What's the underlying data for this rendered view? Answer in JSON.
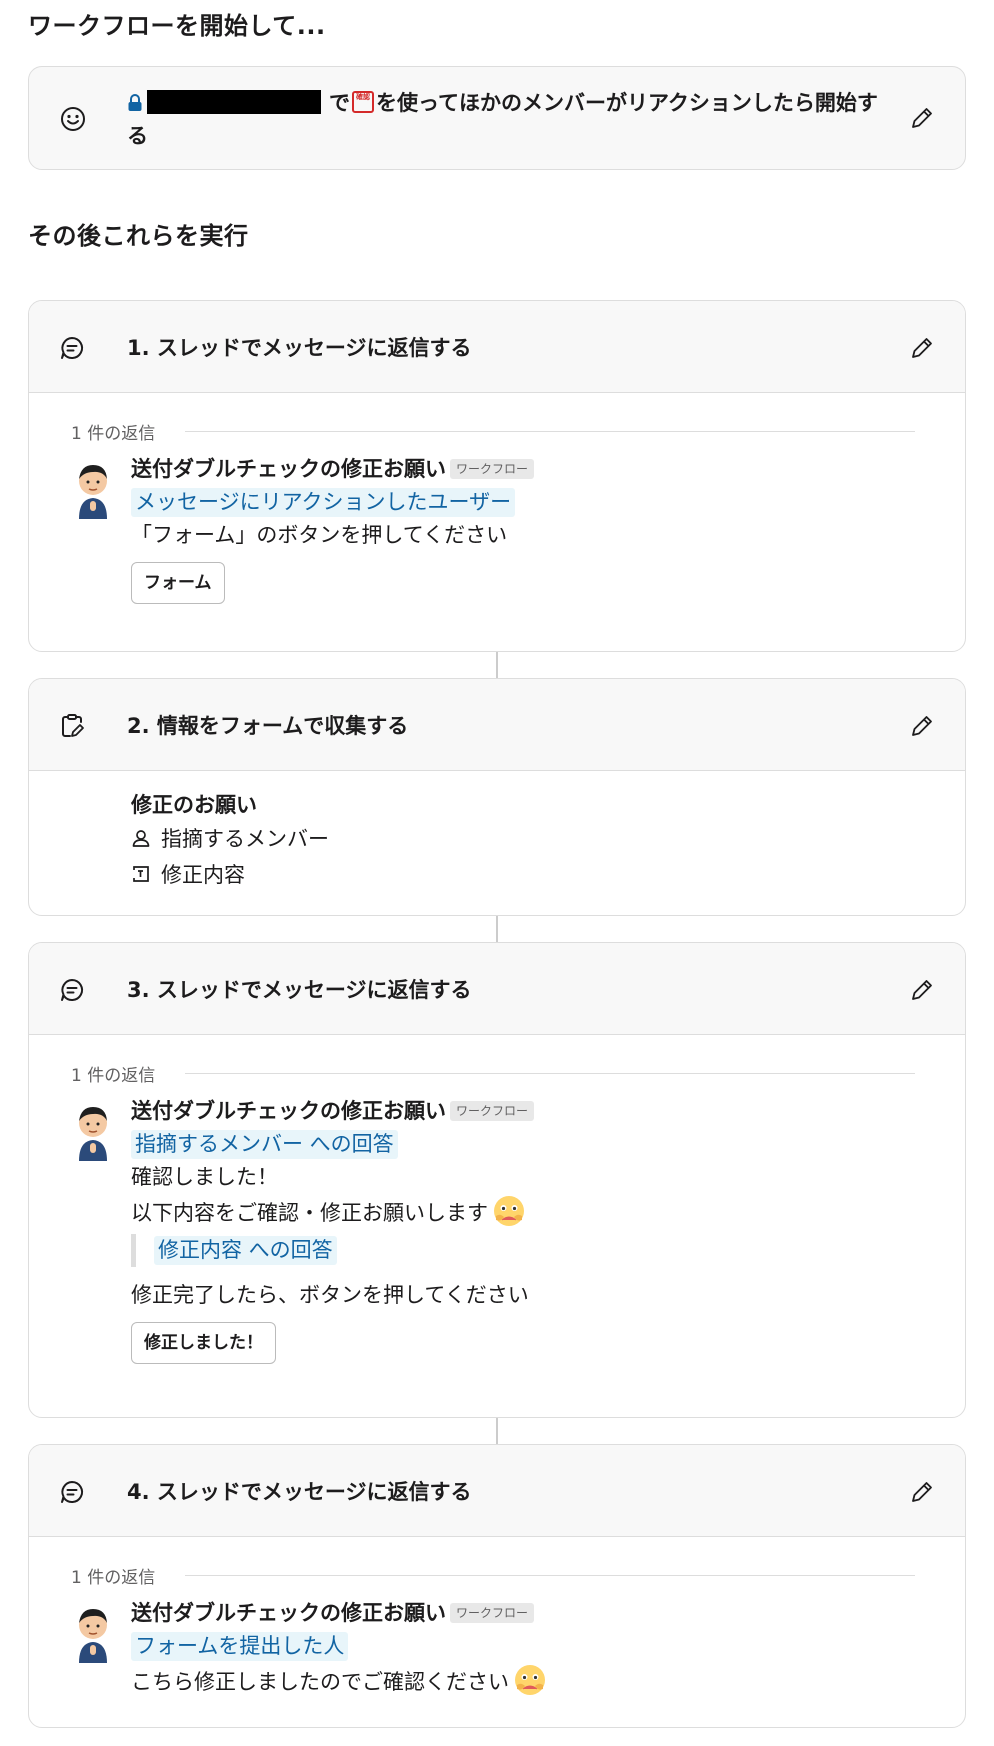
{
  "header": {
    "title": "ワークフローを開始して..."
  },
  "trigger": {
    "text_after": "で",
    "text_main": "を使ってほかのメンバーがリアクションしたら開始する",
    "stamp_text": "確認"
  },
  "then": {
    "title": "その後これらを実行"
  },
  "steps": [
    {
      "title": "1. スレッドでメッセージに返信する",
      "reply_count": "1 件の返信",
      "sender": "送付ダブルチェックの修正お願い",
      "badge": "ワークフロー",
      "mention": "メッセージにリアクションしたユーザー",
      "line1": "「フォーム」のボタンを押してください",
      "button": "フォーム"
    },
    {
      "title": "2. 情報をフォームで収集する",
      "form_title": "修正のお願い",
      "field1": "指摘するメンバー",
      "field2": "修正内容"
    },
    {
      "title": "3. スレッドでメッセージに返信する",
      "reply_count": "1 件の返信",
      "sender": "送付ダブルチェックの修正お願い",
      "badge": "ワークフロー",
      "mention": "指摘するメンバー への回答",
      "line1": "確認しました！",
      "line2": "以下内容をご確認・修正お願いします",
      "quote_mention": "修正内容 への回答",
      "line3": "修正完了したら、ボタンを押してください",
      "button": "修正しました！"
    },
    {
      "title": "4. スレッドでメッセージに返信する",
      "reply_count": "1 件の返信",
      "sender": "送付ダブルチェックの修正お願い",
      "badge": "ワークフロー",
      "mention": "フォームを提出した人",
      "line1": "こちら修正しましたのでご確認ください"
    }
  ],
  "icons": {
    "trigger": "smiley-icon",
    "reply_step": "chat-bubble-icon",
    "form_step": "clipboard-edit-icon",
    "edit": "pencil-icon",
    "lock": "lock-icon",
    "field_user": "person-icon",
    "field_text": "text-field-icon",
    "emoji": "pleading-face-emoji"
  },
  "colors": {
    "mention_text": "#1264a3",
    "mention_bg": "#e8f5fa",
    "lock": "#1264a3"
  }
}
